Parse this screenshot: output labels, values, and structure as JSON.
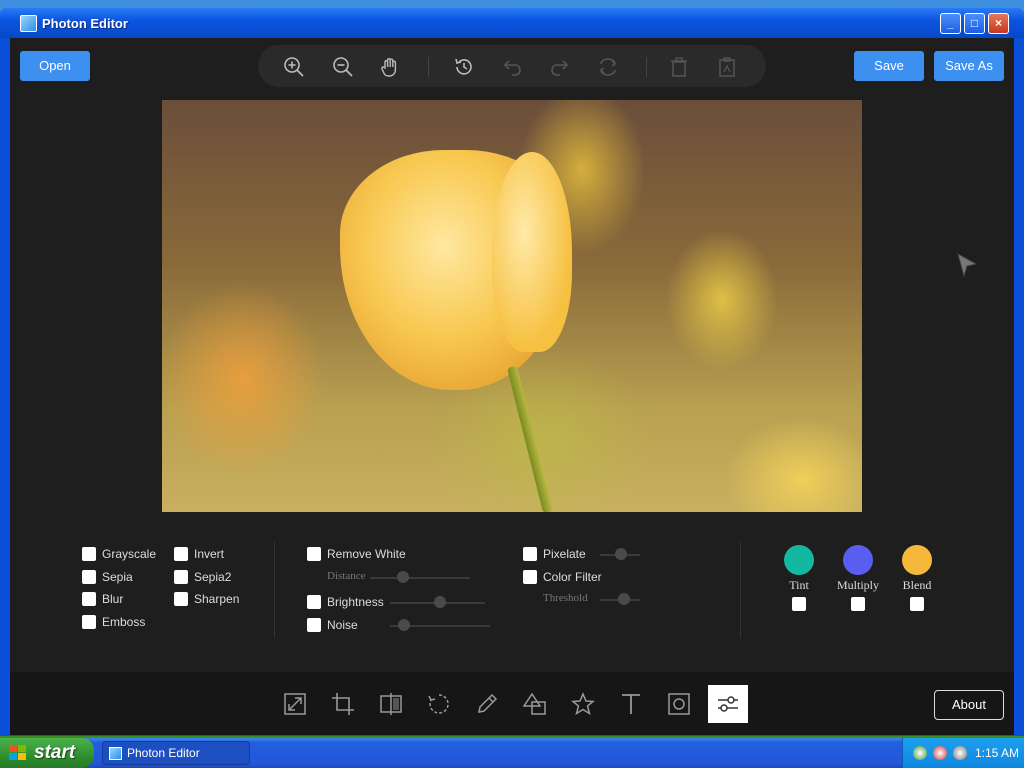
{
  "window": {
    "title": "Photon Editor"
  },
  "header": {
    "open_label": "Open",
    "save_label": "Save",
    "save_as_label": "Save As"
  },
  "toolbar": {
    "icons": [
      "zoom-in-icon",
      "zoom-out-icon",
      "hand-icon",
      "history-icon",
      "undo-icon",
      "redo-icon",
      "reset-icon",
      "delete-icon",
      "clear-icon"
    ]
  },
  "filters": {
    "col1": [
      "Grayscale",
      "Sepia",
      "Blur",
      "Emboss"
    ],
    "col2": [
      "Invert",
      "Sepia2",
      "Sharpen"
    ],
    "remove_white": "Remove White",
    "distance": "Distance",
    "brightness": "Brightness",
    "noise": "Noise",
    "pixelate": "Pixelate",
    "color_filter": "Color Filter",
    "threshold": "Threshold",
    "tint": "Tint",
    "multiply": "Multiply",
    "blend": "Blend"
  },
  "colors": {
    "tint": "#14b8a0",
    "multiply": "#5a5ef0",
    "blend": "#f5b83a",
    "accent": "#3d8ff0"
  },
  "bottom": {
    "tools": [
      "resize-icon",
      "crop-icon",
      "flip-icon",
      "rotate-icon",
      "draw-icon",
      "shapes-icon",
      "star-icon",
      "text-icon",
      "frame-icon",
      "filters-icon"
    ],
    "about_label": "About"
  },
  "taskbar": {
    "start_label": "start",
    "task_label": "Photon Editor",
    "clock": "1:15 AM"
  }
}
